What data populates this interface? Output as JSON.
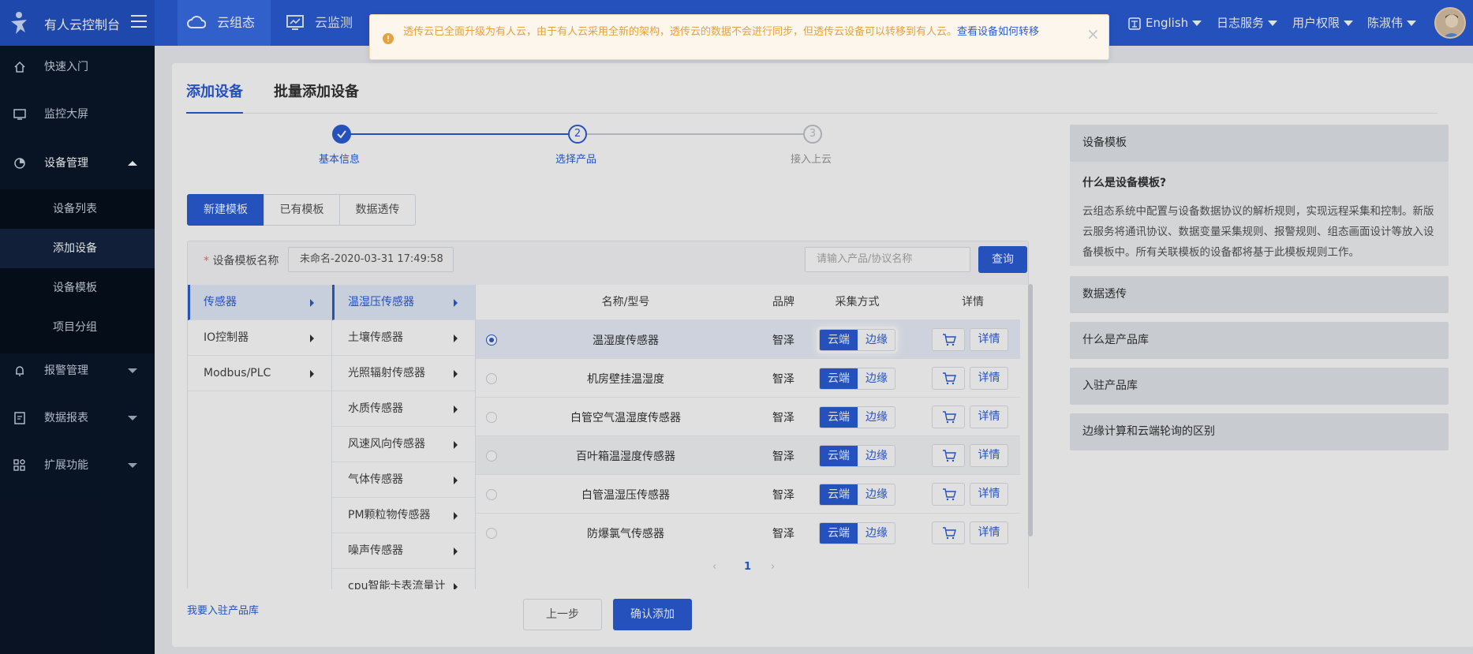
{
  "topbar": {
    "brand_title": "有人云控制台",
    "nav_tabs": [
      "云组态",
      "云监测"
    ],
    "language": "English",
    "log_service": "日志服务",
    "user_permissions": "用户权限",
    "username": "陈淑伟"
  },
  "notice": {
    "text": "透传云已全面升级为有人云，由于有人云采用全新的架构，透传云的数据不会进行同步，但透传云设备可以转移到有人云。",
    "link": "查看设备如何转移"
  },
  "sidebar": {
    "items": [
      "快速入门",
      "监控大屏",
      "设备管理",
      "报警管理",
      "数据报表",
      "扩展功能"
    ],
    "sub_items": [
      "设备列表",
      "添加设备",
      "设备模板",
      "项目分组"
    ]
  },
  "page_tabs": [
    "添加设备",
    "批量添加设备"
  ],
  "steps": [
    "基本信息",
    "选择产品",
    "接入上云"
  ],
  "step_numbers": [
    "2",
    "3"
  ],
  "template_buttons": [
    "新建模板",
    "已有模板",
    "数据透传"
  ],
  "form": {
    "name_label": "设备模板名称",
    "name_value": "未命名-2020-03-31 17:49:58",
    "search_placeholder": "请输入产品/协议名称",
    "query_button": "查询"
  },
  "categories_l1": [
    "传感器",
    "IO控制器",
    "Modbus/PLC"
  ],
  "categories_l2": [
    "温湿压传感器",
    "土壤传感器",
    "光照辐射传感器",
    "水质传感器",
    "风速风向传感器",
    "气体传感器",
    "PM颗粒物传感器",
    "噪声传感器",
    "cpu智能卡表流量计"
  ],
  "table": {
    "headers": [
      "名称/型号",
      "品牌",
      "采集方式",
      "详情"
    ],
    "collect_cloud": "云端",
    "collect_edge": "边缘",
    "detail_label": "详情",
    "rows": [
      {
        "name": "温湿度传感器",
        "brand": "智泽"
      },
      {
        "name": "机房壁挂温湿度",
        "brand": "智泽"
      },
      {
        "name": "白管空气温湿度传感器",
        "brand": "智泽"
      },
      {
        "name": "百叶箱温湿度传感器",
        "brand": "智泽"
      },
      {
        "name": "白管温湿压传感器",
        "brand": "智泽"
      },
      {
        "name": "防爆氯气传感器",
        "brand": "智泽"
      }
    ]
  },
  "pagination": {
    "current": "1"
  },
  "footer": {
    "join_link": "我要入驻产品库",
    "prev_button": "上一步",
    "confirm_button": "确认添加"
  },
  "help_panel": {
    "title": "设备模板",
    "question": "什么是设备模板?",
    "answer": "云组态系统中配置与设备数据协议的解析规则，实现远程采集和控制。新版云服务将通讯协议、数据变量采集规则、报警规则、组态画面设计等放入设备模板中。所有关联模板的设备都将基于此模板规则工作。",
    "sections": [
      "数据透传",
      "什么是产品库",
      "入驻产品库",
      "边缘计算和云端轮询的区别"
    ]
  },
  "colors": {
    "primary": "#2a5dd6",
    "sidebar_bg": "#0a1628",
    "warning": "#e6a23c"
  }
}
